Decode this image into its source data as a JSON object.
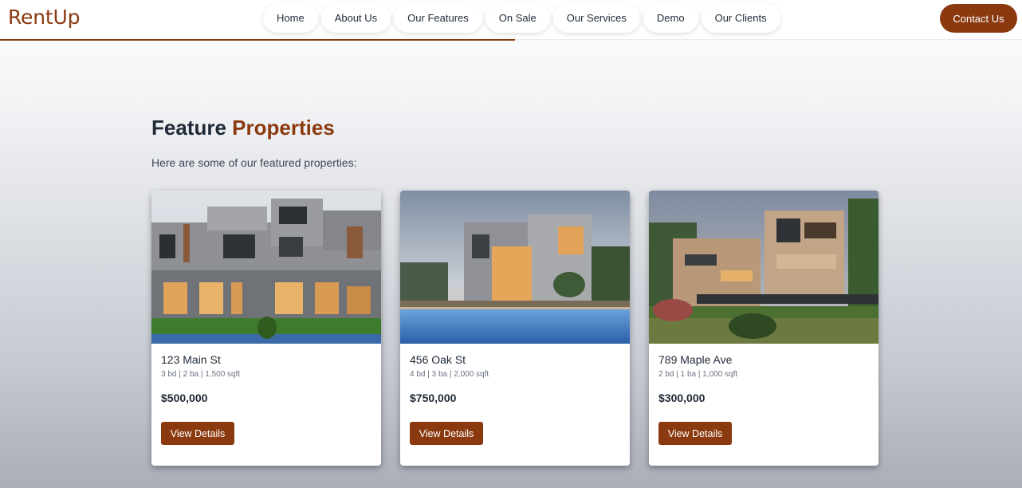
{
  "brand": {
    "logo": "RentUp",
    "accent": "#8b3a10"
  },
  "nav": {
    "items": [
      {
        "label": "Home"
      },
      {
        "label": "About Us"
      },
      {
        "label": "Our Features"
      },
      {
        "label": "On Sale"
      },
      {
        "label": "Our Services"
      },
      {
        "label": "Demo"
      },
      {
        "label": "Our Clients"
      }
    ],
    "contact_label": "Contact Us"
  },
  "section": {
    "title_main": "Feature",
    "title_accent": "Properties",
    "subtitle": "Here are some of our featured properties:"
  },
  "properties": [
    {
      "address": "123 Main St",
      "specs": "3 bd | 2 ba | 1,500 sqft",
      "price": "$500,000",
      "button": "View Details"
    },
    {
      "address": "456 Oak St",
      "specs": "4 bd | 3 ba | 2,000 sqft",
      "price": "$750,000",
      "button": "View Details"
    },
    {
      "address": "789 Maple Ave",
      "specs": "2 bd | 1 ba | 1,000 sqft",
      "price": "$300,000",
      "button": "View Details"
    }
  ]
}
